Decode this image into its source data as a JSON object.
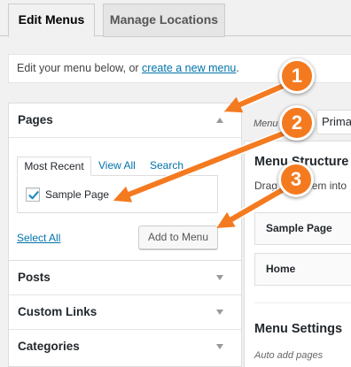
{
  "tabs": [
    {
      "label": "Edit Menus"
    },
    {
      "label": "Manage Locations"
    }
  ],
  "info": {
    "prefix": "Edit your menu below, or ",
    "link": "create a new menu",
    "suffix": "."
  },
  "sidebar": {
    "sections": [
      {
        "title": "Pages"
      },
      {
        "title": "Posts"
      },
      {
        "title": "Custom Links"
      },
      {
        "title": "Categories"
      }
    ],
    "pages": {
      "subtabs": [
        "Most Recent",
        "View All",
        "Search"
      ],
      "item_label": "Sample Page",
      "item_checked": true,
      "select_all": "Select All",
      "add_button": "Add to Menu"
    }
  },
  "right": {
    "menu_name_label": "Menu",
    "menu_select_value": "Primary",
    "structure_title": "Menu Structure",
    "drag_text": "Drag each item into",
    "items": [
      "Sample Page",
      "Home"
    ],
    "settings_title": "Menu Settings",
    "auto_add": "Auto add pages"
  },
  "callouts": [
    "1",
    "2",
    "3"
  ],
  "colors": {
    "accent": "#f47a20",
    "link": "#0073aa",
    "check": "#1e8cbe"
  }
}
